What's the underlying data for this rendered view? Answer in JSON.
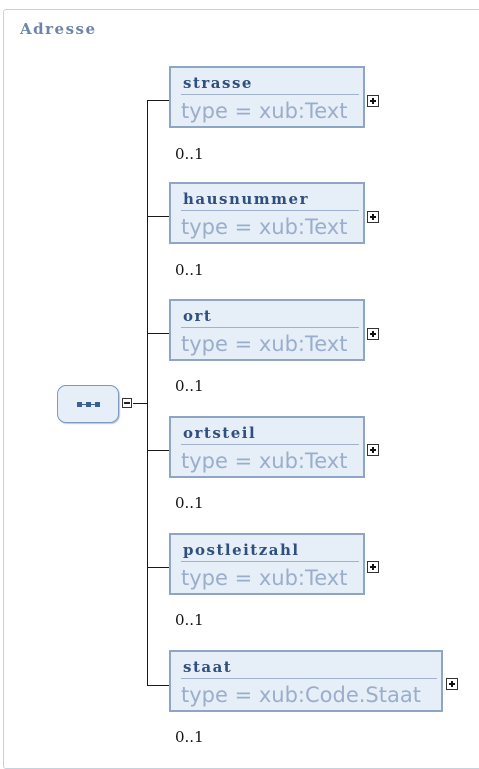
{
  "title": "Adresse",
  "elements": [
    {
      "name": "strasse",
      "type": "type = xub:Text",
      "cardinality": "0..1"
    },
    {
      "name": "hausnummer",
      "type": "type = xub:Text",
      "cardinality": "0..1"
    },
    {
      "name": "ort",
      "type": "type = xub:Text",
      "cardinality": "0..1"
    },
    {
      "name": "ortsteil",
      "type": "type = xub:Text",
      "cardinality": "0..1"
    },
    {
      "name": "postleitzahl",
      "type": "type = xub:Text",
      "cardinality": "0..1"
    },
    {
      "name": "staat",
      "type": "type = xub:Code.Staat",
      "cardinality": "0..1"
    }
  ]
}
